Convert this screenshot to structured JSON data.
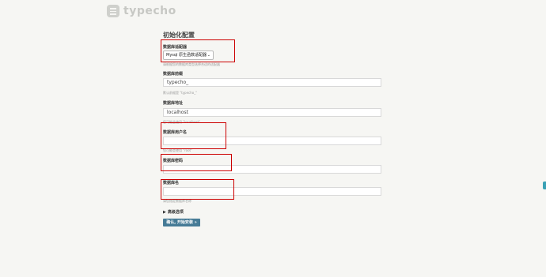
{
  "logo": {
    "text": "typecho"
  },
  "form": {
    "title": "初始化配置",
    "adapter": {
      "label": "数据库适配器",
      "selected": "Mysql 原生函数适配器",
      "hint": "请根据您的数据库类型选择合适的适配器"
    },
    "prefix": {
      "label": "数据库前缀",
      "value": "typecho_",
      "hint": "默认前缀是 \"typecho_\""
    },
    "host": {
      "label": "数据库地址",
      "value": "localhost",
      "hint": "您可能会使用 \"localhost\""
    },
    "user": {
      "label": "数据库用户名",
      "value": "",
      "hint": "您可能会使用 \"root\""
    },
    "password": {
      "label": "数据库密码",
      "value": ""
    },
    "dbname": {
      "label": "数据库名",
      "value": "",
      "hint": "请您指定数据库名称"
    },
    "advanced_label": "高级选项",
    "submit_label": "确认, 开始安装 »"
  },
  "colors": {
    "highlight": "#cc0000",
    "button": "#467b96",
    "background": "#f6f6f3"
  }
}
